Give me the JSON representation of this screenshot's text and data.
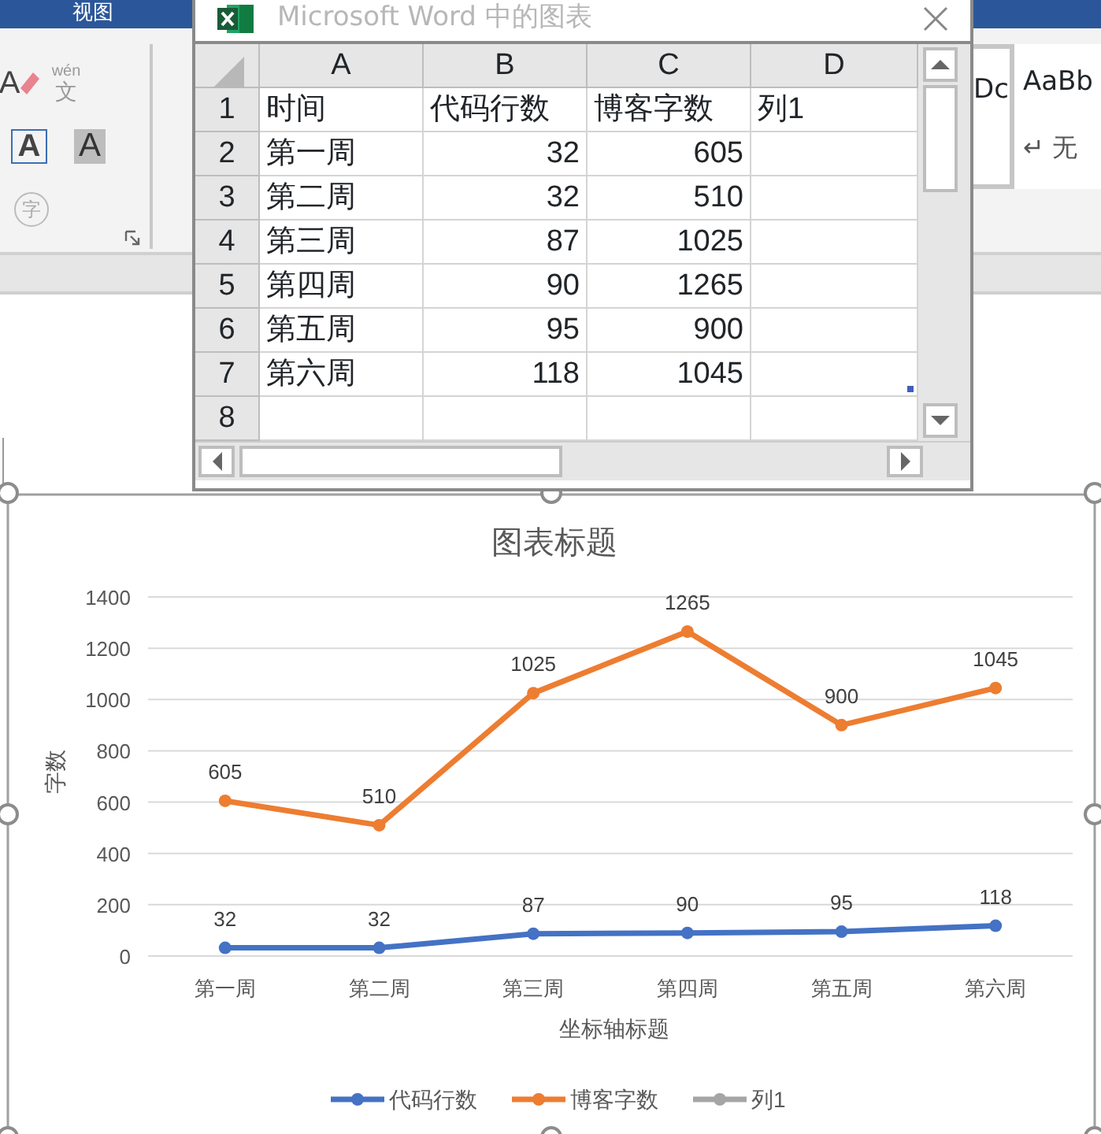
{
  "app_tab": "视图",
  "ribbon": {
    "tools": [
      {
        "kind": "eraser",
        "label": "A"
      },
      {
        "kind": "phonetic",
        "label": "wén",
        "sub": "文"
      },
      {
        "kind": "boxed",
        "label": "A"
      },
      {
        "kind": "shaded",
        "label": "A"
      },
      {
        "kind": "circled",
        "label": "字"
      }
    ],
    "styles": [
      {
        "label": "Dc",
        "selected": true
      },
      {
        "label": "AaBb",
        "caption": "↵ 无",
        "selected": false
      }
    ]
  },
  "excel": {
    "title": "Microsoft Word 中的图表",
    "columns": [
      "A",
      "B",
      "C",
      "D"
    ],
    "rows": [
      {
        "num": "1",
        "kind": "header",
        "cells": [
          "时间",
          "代码行数",
          "博客字数",
          "列1"
        ]
      },
      {
        "num": "2",
        "kind": "data",
        "cells": [
          "第一周",
          "32",
          "605"
        ]
      },
      {
        "num": "3",
        "kind": "data",
        "cells": [
          "第二周",
          "32",
          "510"
        ]
      },
      {
        "num": "4",
        "kind": "data",
        "cells": [
          "第三周",
          "87",
          "1025"
        ]
      },
      {
        "num": "5",
        "kind": "data",
        "cells": [
          "第四周",
          "90",
          "1265"
        ]
      },
      {
        "num": "6",
        "kind": "data",
        "cells": [
          "第五周",
          "95",
          "900"
        ]
      },
      {
        "num": "7",
        "kind": "data",
        "cells": [
          "第六周",
          "118",
          "1045"
        ]
      },
      {
        "num": "8",
        "kind": "data",
        "cells": []
      }
    ]
  },
  "chart": {
    "chart_data": {
      "type": "line",
      "title": "图表标题",
      "xlabel": "坐标轴标题",
      "ylabel": "字数",
      "categories": [
        "第一周",
        "第二周",
        "第三周",
        "第四周",
        "第五周",
        "第六周"
      ],
      "series": [
        {
          "name": "代码行数",
          "color": "#4472c4",
          "marker": "circle",
          "values": [
            32,
            32,
            87,
            90,
            95,
            118
          ],
          "value_labels": [
            "32",
            "32",
            "87",
            "90",
            "95",
            "118"
          ]
        },
        {
          "name": "博客字数",
          "color": "#ed7d31",
          "marker": "circle",
          "values": [
            605,
            510,
            1025,
            1265,
            900,
            1045
          ],
          "value_labels": [
            "605",
            "510",
            "1025",
            "1265",
            "900",
            "1045"
          ]
        },
        {
          "name": "列1",
          "color": "#a5a5a5",
          "marker": "circle",
          "values": [
            null,
            null,
            null,
            null,
            null,
            null
          ]
        }
      ],
      "ylim": [
        0,
        1400
      ],
      "yticks": [
        0,
        200,
        400,
        600,
        800,
        1000,
        1200,
        1400
      ],
      "grid": true,
      "legend": true,
      "data_labels": true
    }
  }
}
